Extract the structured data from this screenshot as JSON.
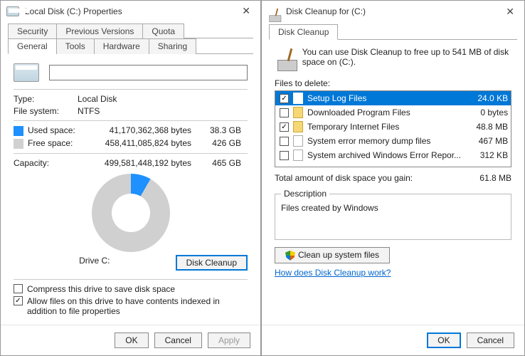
{
  "properties": {
    "title": "Local Disk (C:) Properties",
    "tabs_row1": [
      "Security",
      "Previous Versions",
      "Quota"
    ],
    "tabs_row2": [
      "General",
      "Tools",
      "Hardware",
      "Sharing"
    ],
    "active_tab": "General",
    "type_label": "Type:",
    "type_value": "Local Disk",
    "fs_label": "File system:",
    "fs_value": "NTFS",
    "used_label": "Used space:",
    "used_bytes": "41,170,362,368 bytes",
    "used_gb": "38.3 GB",
    "free_label": "Free space:",
    "free_bytes": "458,411,085,824 bytes",
    "free_gb": "426 GB",
    "capacity_label": "Capacity:",
    "capacity_bytes": "499,581,448,192 bytes",
    "capacity_gb": "465 GB",
    "drive_label": "Drive C:",
    "disk_cleanup_btn": "Disk Cleanup",
    "compress_label": "Compress this drive to save disk space",
    "index_label": "Allow files on this drive to have contents indexed in addition to file properties",
    "ok": "OK",
    "cancel": "Cancel",
    "apply": "Apply"
  },
  "cleanup": {
    "title": "Disk Cleanup for  (C:)",
    "tab": "Disk Cleanup",
    "headline": "You can use Disk Cleanup to free up to 541 MB of disk space on  (C:).",
    "files_to_delete": "Files to delete:",
    "items": [
      {
        "checked": true,
        "name": "Setup Log Files",
        "size": "24.0 KB",
        "icon": "file",
        "selected": true
      },
      {
        "checked": false,
        "name": "Downloaded Program Files",
        "size": "0 bytes",
        "icon": "folder",
        "selected": false
      },
      {
        "checked": true,
        "name": "Temporary Internet Files",
        "size": "48.8 MB",
        "icon": "folder",
        "selected": false
      },
      {
        "checked": false,
        "name": "System error memory dump files",
        "size": "467 MB",
        "icon": "file",
        "selected": false
      },
      {
        "checked": false,
        "name": "System archived Windows Error Repor...",
        "size": "312 KB",
        "icon": "file",
        "selected": false
      }
    ],
    "total_label": "Total amount of disk space you gain:",
    "total_value": "61.8 MB",
    "desc_legend": "Description",
    "desc_text": "Files created by Windows",
    "cleanup_system_btn": "Clean up system files",
    "help_link": "How does Disk Cleanup work?",
    "ok": "OK",
    "cancel": "Cancel"
  }
}
